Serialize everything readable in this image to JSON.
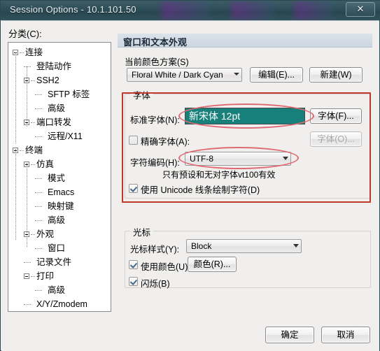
{
  "window": {
    "title": "Session Options - 10.1.101.50",
    "close_label": "✕"
  },
  "category": {
    "label": "分类(C):",
    "tree": [
      {
        "label": "连接",
        "depth": 0,
        "expander": true
      },
      {
        "label": "登陆动作",
        "depth": 1,
        "expander": false
      },
      {
        "label": "SSH2",
        "depth": 1,
        "expander": true
      },
      {
        "label": "SFTP 标签",
        "depth": 2,
        "expander": false
      },
      {
        "label": "高级",
        "depth": 2,
        "expander": false
      },
      {
        "label": "端口转发",
        "depth": 1,
        "expander": true
      },
      {
        "label": "远程/X11",
        "depth": 2,
        "expander": false
      },
      {
        "label": "终端",
        "depth": 0,
        "expander": true
      },
      {
        "label": "仿真",
        "depth": 1,
        "expander": true
      },
      {
        "label": "模式",
        "depth": 2,
        "expander": false
      },
      {
        "label": "Emacs",
        "depth": 2,
        "expander": false
      },
      {
        "label": "映射键",
        "depth": 2,
        "expander": false
      },
      {
        "label": "高级",
        "depth": 2,
        "expander": false
      },
      {
        "label": "外观",
        "depth": 1,
        "expander": true
      },
      {
        "label": "窗口",
        "depth": 2,
        "expander": false
      },
      {
        "label": "记录文件",
        "depth": 1,
        "expander": false
      },
      {
        "label": "打印",
        "depth": 1,
        "expander": true
      },
      {
        "label": "高级",
        "depth": 2,
        "expander": false
      },
      {
        "label": "X/Y/Zmodem",
        "depth": 1,
        "expander": false
      }
    ]
  },
  "panel": {
    "header": "窗口和文本外观",
    "color_scheme": {
      "label": "当前颜色方案(S)",
      "value": "Floral White / Dark Cyan",
      "edit_button": "编辑(E)...",
      "new_button": "新建(W)"
    },
    "font_group": {
      "title": "字体",
      "normal_font_label": "标准字体(N):",
      "normal_font_value": "新宋体  12pt",
      "normal_font_button": "字体(F)...",
      "exact_font_label": "精确字体(A):",
      "exact_font_checked": false,
      "exact_font_button": "字体(O)...",
      "charset_label": "字符编码(H):",
      "charset_value": "UTF-8",
      "charset_hint": "只有预设和无对字体vt100有效",
      "unicode_line_label": "使用 Unicode 线条绘制字符(D)",
      "unicode_line_checked": true,
      "highlight_color": "#17807a"
    },
    "cursor_group": {
      "title": "光标",
      "style_label": "光标样式(Y):",
      "style_value": "Block",
      "use_color_label": "使用颜色(U):",
      "use_color_checked": true,
      "color_button": "颜色(R)...",
      "blink_label": "闪烁(B)",
      "blink_checked": true
    }
  },
  "footer": {
    "ok_button": "确定",
    "cancel_button": "取消"
  },
  "annotations": {
    "accent_color": "#c0392b",
    "ellipse_color": "#e06a73"
  }
}
